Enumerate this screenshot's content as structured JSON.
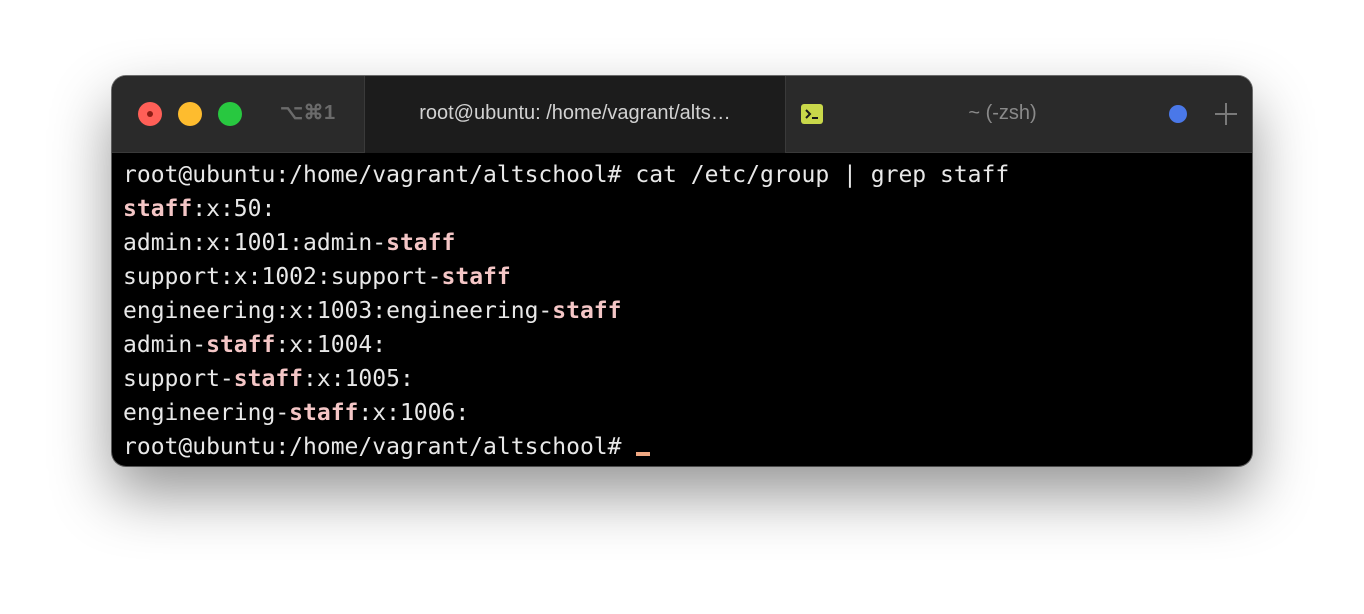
{
  "window": {
    "shortcut_label": "⌥⌘1",
    "active_tab_title": "root@ubuntu: /home/vagrant/alts…",
    "inactive_tab_title": "~ (-zsh)",
    "new_tab_symbol": "+",
    "colors": {
      "close": "#ff5f57",
      "minimize": "#febc2e",
      "maximize": "#28c840",
      "highlight": "#f4c6c6",
      "cursor": "#f0a882",
      "indicator_dot": "#4a78e8",
      "terminal_icon": "#c9d84a"
    }
  },
  "terminal": {
    "lines": [
      {
        "segments": [
          {
            "text": "root@ubuntu:/home/vagrant/altschool# cat /etc/group | grep staff",
            "hl": false
          }
        ]
      },
      {
        "segments": [
          {
            "text": "staff",
            "hl": true
          },
          {
            "text": ":x:50:",
            "hl": false
          }
        ]
      },
      {
        "segments": [
          {
            "text": "admin:x:1001:admin-",
            "hl": false
          },
          {
            "text": "staff",
            "hl": true
          }
        ]
      },
      {
        "segments": [
          {
            "text": "support:x:1002:support-",
            "hl": false
          },
          {
            "text": "staff",
            "hl": true
          }
        ]
      },
      {
        "segments": [
          {
            "text": "engineering:x:1003:engineering-",
            "hl": false
          },
          {
            "text": "staff",
            "hl": true
          }
        ]
      },
      {
        "segments": [
          {
            "text": "admin-",
            "hl": false
          },
          {
            "text": "staff",
            "hl": true
          },
          {
            "text": ":x:1004:",
            "hl": false
          }
        ]
      },
      {
        "segments": [
          {
            "text": "support-",
            "hl": false
          },
          {
            "text": "staff",
            "hl": true
          },
          {
            "text": ":x:1005:",
            "hl": false
          }
        ]
      },
      {
        "segments": [
          {
            "text": "engineering-",
            "hl": false
          },
          {
            "text": "staff",
            "hl": true
          },
          {
            "text": ":x:1006:",
            "hl": false
          }
        ]
      }
    ],
    "prompt": "root@ubuntu:/home/vagrant/altschool# "
  }
}
